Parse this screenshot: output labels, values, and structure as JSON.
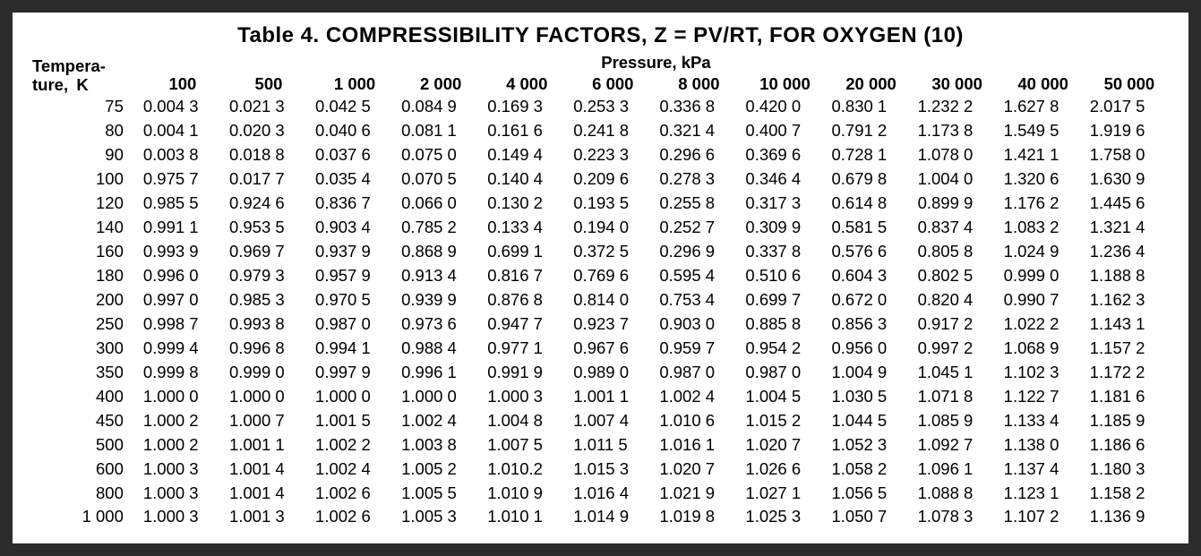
{
  "title": "Table  4.  COMPRESSIBILITY FACTORS, Z = PV/RT, FOR OXYGEN (10)",
  "row_header_line1": "Tempera-",
  "row_header_line2": "ture, K",
  "pressure_header": "Pressure, kPa",
  "pressure_columns": [
    "100",
    "500",
    "1 000",
    "2 000",
    "4 000",
    "6 000",
    "8 000",
    "10 000",
    "20 000",
    "30 000",
    "40 000",
    "50 000"
  ],
  "rows": [
    {
      "temp": "75",
      "z": [
        "0.004 3",
        "0.021 3",
        "0.042 5",
        "0.084 9",
        "0.169 3",
        "0.253 3",
        "0.336 8",
        "0.420 0",
        "0.830 1",
        "1.232 2",
        "1.627 8",
        "2.017 5"
      ]
    },
    {
      "temp": "80",
      "z": [
        "0.004 1",
        "0.020 3",
        "0.040 6",
        "0.081 1",
        "0.161 6",
        "0.241 8",
        "0.321 4",
        "0.400 7",
        "0.791 2",
        "1.173 8",
        "1.549 5",
        "1.919 6"
      ]
    },
    {
      "temp": "90",
      "z": [
        "0.003 8",
        "0.018 8",
        "0.037 6",
        "0.075 0",
        "0.149 4",
        "0.223 3",
        "0.296 6",
        "0.369 6",
        "0.728 1",
        "1.078 0",
        "1.421 1",
        "1.758 0"
      ]
    },
    {
      "temp": "100",
      "z": [
        "0.975 7",
        "0.017 7",
        "0.035 4",
        "0.070 5",
        "0.140 4",
        "0.209 6",
        "0.278 3",
        "0.346 4",
        "0.679 8",
        "1.004 0",
        "1.320 6",
        "1.630 9"
      ]
    },
    {
      "temp": "120",
      "z": [
        "0.985 5",
        "0.924 6",
        "0.836 7",
        "0.066 0",
        "0.130 2",
        "0.193 5",
        "0.255 8",
        "0.317 3",
        "0.614 8",
        "0.899 9",
        "1.176 2",
        "1.445 6"
      ]
    },
    {
      "temp": "140",
      "z": [
        "0.991 1",
        "0.953 5",
        "0.903 4",
        "0.785 2",
        "0.133 4",
        "0.194 0",
        "0.252 7",
        "0.309 9",
        "0.581 5",
        "0.837 4",
        "1.083 2",
        "1.321 4"
      ]
    },
    {
      "temp": "160",
      "z": [
        "0.993 9",
        "0.969 7",
        "0.937 9",
        "0.868 9",
        "0.699 1",
        "0.372 5",
        "0.296 9",
        "0.337 8",
        "0.576 6",
        "0.805 8",
        "1.024 9",
        "1.236 4"
      ]
    },
    {
      "temp": "180",
      "z": [
        "0.996 0",
        "0.979 3",
        "0.957 9",
        "0.913 4",
        "0.816 7",
        "0.769 6",
        "0.595 4",
        "0.510 6",
        "0.604 3",
        "0.802 5",
        "0.999 0",
        "1.188 8"
      ]
    },
    {
      "temp": "200",
      "z": [
        "0.997 0",
        "0.985 3",
        "0.970 5",
        "0.939 9",
        "0.876 8",
        "0.814 0",
        "0.753 4",
        "0.699 7",
        "0.672 0",
        "0.820 4",
        "0.990 7",
        "1.162 3"
      ]
    },
    {
      "temp": "250",
      "z": [
        "0.998 7",
        "0.993 8",
        "0.987 0",
        "0.973 6",
        "0.947 7",
        "0.923 7",
        "0.903 0",
        "0.885 8",
        "0.856 3",
        "0.917 2",
        "1.022 2",
        "1.143 1"
      ]
    },
    {
      "temp": "300",
      "z": [
        "0.999 4",
        "0.996 8",
        "0.994 1",
        "0.988 4",
        "0.977 1",
        "0.967 6",
        "0.959 7",
        "0.954 2",
        "0.956 0",
        "0.997 2",
        "1.068 9",
        "1.157 2"
      ]
    },
    {
      "temp": "350",
      "z": [
        "0.999 8",
        "0.999 0",
        "0.997 9",
        "0.996 1",
        "0.991 9",
        "0.989 0",
        "0.987 0",
        "0.987 0",
        "1.004 9",
        "1.045 1",
        "1.102 3",
        "1.172 2"
      ]
    },
    {
      "temp": "400",
      "z": [
        "1.000 0",
        "1.000 0",
        "1.000 0",
        "1.000 0",
        "1.000 3",
        "1.001 1",
        "1.002 4",
        "1.004 5",
        "1.030 5",
        "1.071 8",
        "1.122 7",
        "1.181 6"
      ]
    },
    {
      "temp": "450",
      "z": [
        "1.000 2",
        "1.000 7",
        "1.001 5",
        "1.002 4",
        "1.004 8",
        "1.007 4",
        "1.010 6",
        "1.015 2",
        "1.044 5",
        "1.085 9",
        "1.133 4",
        "1.185 9"
      ]
    },
    {
      "temp": "500",
      "z": [
        "1.000 2",
        "1.001 1",
        "1.002 2",
        "1.003 8",
        "1.007 5",
        "1.011 5",
        "1.016 1",
        "1.020 7",
        "1.052 3",
        "1.092 7",
        "1.138 0",
        "1.186 6"
      ]
    },
    {
      "temp": "600",
      "z": [
        "1.000 3",
        "1.001 4",
        "1.002 4",
        "1.005 2",
        "1.010.2",
        "1.015 3",
        "1.020 7",
        "1.026 6",
        "1.058 2",
        "1.096 1",
        "1.137 4",
        "1.180 3"
      ]
    },
    {
      "temp": "800",
      "z": [
        "1.000 3",
        "1.001 4",
        "1.002 6",
        "1.005 5",
        "1.010 9",
        "1.016 4",
        "1.021 9",
        "1.027 1",
        "1.056 5",
        "1.088 8",
        "1.123 1",
        "1.158 2"
      ]
    },
    {
      "temp": "1 000",
      "z": [
        "1.000 3",
        "1.001 3",
        "1.002 6",
        "1.005 3",
        "1.010 1",
        "1.014 9",
        "1.019 8",
        "1.025 3",
        "1.050 7",
        "1.078 3",
        "1.107 2",
        "1.136 9"
      ]
    }
  ],
  "chart_data": {
    "type": "table",
    "title": "Compressibility Factors Z = PV/RT for Oxygen",
    "xlabel": "Pressure, kPa",
    "ylabel": "Temperature, K",
    "x": [
      100,
      500,
      1000,
      2000,
      4000,
      6000,
      8000,
      10000,
      20000,
      30000,
      40000,
      50000
    ],
    "y": [
      75,
      80,
      90,
      100,
      120,
      140,
      160,
      180,
      200,
      250,
      300,
      350,
      400,
      450,
      500,
      600,
      800,
      1000
    ],
    "z": [
      [
        0.0043,
        0.0213,
        0.0425,
        0.0849,
        0.1693,
        0.2533,
        0.3368,
        0.42,
        0.8301,
        1.2322,
        1.6278,
        2.0175
      ],
      [
        0.0041,
        0.0203,
        0.0406,
        0.0811,
        0.1616,
        0.2418,
        0.3214,
        0.4007,
        0.7912,
        1.1738,
        1.5495,
        1.9196
      ],
      [
        0.0038,
        0.0188,
        0.0376,
        0.075,
        0.1494,
        0.2233,
        0.2966,
        0.3696,
        0.7281,
        1.078,
        1.4211,
        1.758
      ],
      [
        0.9757,
        0.0177,
        0.0354,
        0.0705,
        0.1404,
        0.2096,
        0.2783,
        0.3464,
        0.6798,
        1.004,
        1.3206,
        1.6309
      ],
      [
        0.9855,
        0.9246,
        0.8367,
        0.066,
        0.1302,
        0.1935,
        0.2558,
        0.3173,
        0.6148,
        0.8999,
        1.1762,
        1.4456
      ],
      [
        0.9911,
        0.9535,
        0.9034,
        0.7852,
        0.1334,
        0.194,
        0.2527,
        0.3099,
        0.5815,
        0.8374,
        1.0832,
        1.3214
      ],
      [
        0.9939,
        0.9697,
        0.9379,
        0.8689,
        0.6991,
        0.3725,
        0.2969,
        0.3378,
        0.5766,
        0.8058,
        1.0249,
        1.2364
      ],
      [
        0.996,
        0.9793,
        0.9579,
        0.9134,
        0.8167,
        0.7696,
        0.5954,
        0.5106,
        0.6043,
        0.8025,
        0.999,
        1.1888
      ],
      [
        0.997,
        0.9853,
        0.9705,
        0.9399,
        0.8768,
        0.814,
        0.7534,
        0.6997,
        0.672,
        0.8204,
        0.9907,
        1.1623
      ],
      [
        0.9987,
        0.9938,
        0.987,
        0.9736,
        0.9477,
        0.9237,
        0.903,
        0.8858,
        0.8563,
        0.9172,
        1.0222,
        1.1431
      ],
      [
        0.9994,
        0.9968,
        0.9941,
        0.9884,
        0.9771,
        0.9676,
        0.9597,
        0.9542,
        0.956,
        0.9972,
        1.0689,
        1.1572
      ],
      [
        0.9998,
        0.999,
        0.9979,
        0.9961,
        0.9919,
        0.989,
        0.987,
        0.987,
        1.0049,
        1.0451,
        1.1023,
        1.1722
      ],
      [
        1.0,
        1.0,
        1.0,
        1.0,
        1.0003,
        1.0011,
        1.0024,
        1.0045,
        1.0305,
        1.0718,
        1.1227,
        1.1816
      ],
      [
        1.0002,
        1.0007,
        1.0015,
        1.0024,
        1.0048,
        1.0074,
        1.0106,
        1.0152,
        1.0445,
        1.0859,
        1.1334,
        1.1859
      ],
      [
        1.0002,
        1.0011,
        1.0022,
        1.0038,
        1.0075,
        1.0115,
        1.0161,
        1.0207,
        1.0523,
        1.0927,
        1.138,
        1.1866
      ],
      [
        1.0003,
        1.0014,
        1.0024,
        1.0052,
        1.0102,
        1.0153,
        1.0207,
        1.0266,
        1.0582,
        1.0961,
        1.1374,
        1.1803
      ],
      [
        1.0003,
        1.0014,
        1.0026,
        1.0055,
        1.0109,
        1.0164,
        1.0219,
        1.0271,
        1.0565,
        1.0888,
        1.1231,
        1.1582
      ],
      [
        1.0003,
        1.0013,
        1.0026,
        1.0053,
        1.0101,
        1.0149,
        1.0198,
        1.0253,
        1.0507,
        1.0783,
        1.1072,
        1.1369
      ]
    ]
  }
}
